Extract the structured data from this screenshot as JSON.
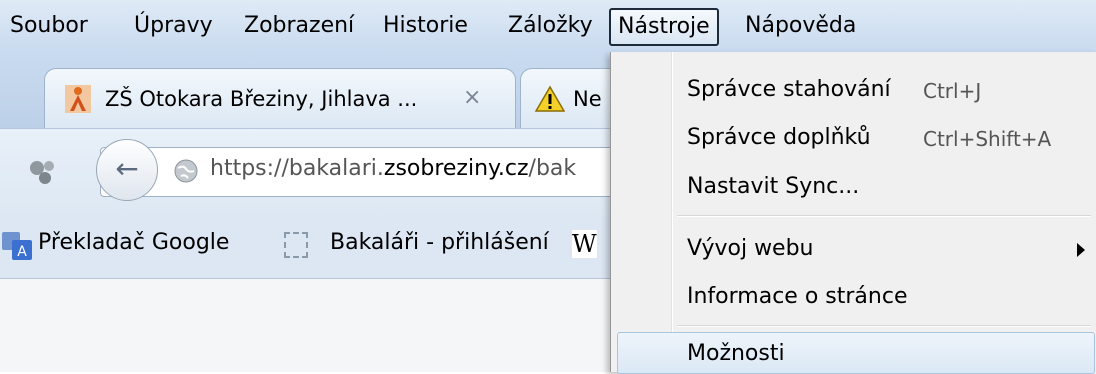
{
  "menubar": {
    "items": [
      "Soubor",
      "Úpravy",
      "Zobrazení",
      "Historie",
      "Záložky",
      "Nástroje",
      "Nápověda"
    ],
    "active": "Nástroje"
  },
  "tabs": [
    {
      "title": "ZŠ Otokara Březiny, Jihlava ...",
      "close": "×",
      "icon": "school-favicon-icon"
    },
    {
      "title": "Ne",
      "icon": "warning-icon"
    }
  ],
  "navbar": {
    "url_prefix": "https://bakalari.",
    "url_domain": "zsobreziny.cz",
    "url_suffix": "/bak"
  },
  "bookmarks": [
    {
      "label": "Překladač Google",
      "icon": "translate-icon"
    },
    {
      "label": "Bakaláři - přihlášení",
      "icon": "blank-page-icon"
    },
    {
      "label": "W",
      "icon": "wikipedia-icon"
    }
  ],
  "dropdown": {
    "items": [
      {
        "label": "Správce stahování",
        "shortcut": "Ctrl+J"
      },
      {
        "label": "Správce doplňků",
        "shortcut": "Ctrl+Shift+A"
      },
      {
        "label": "Nastavit Sync..."
      },
      {
        "label": "Vývoj webu",
        "submenu": true
      },
      {
        "label": "Informace o stránce"
      },
      {
        "label": "Možnosti",
        "highlighted": true
      }
    ]
  }
}
